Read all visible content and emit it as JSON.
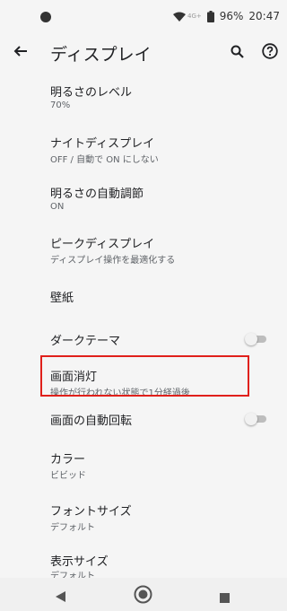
{
  "status": {
    "network": "4G+",
    "battery": "96%",
    "time": "20:47"
  },
  "header": {
    "title": "ディスプレイ"
  },
  "settings": [
    {
      "title": "明るさのレベル",
      "subtitle": "70%"
    },
    {
      "title": "ナイトディスプレイ",
      "subtitle": "OFF / 自動で ON にしない"
    },
    {
      "title": "明るさの自動調節",
      "subtitle": "ON"
    },
    {
      "title": "ピークディスプレイ",
      "subtitle": "ディスプレイ操作を最適化する"
    },
    {
      "title": "壁紙"
    },
    {
      "title": "ダークテーマ",
      "toggle": "off"
    },
    {
      "title": "画面消灯",
      "subtitle": "操作が行われない状態で1分経過後"
    },
    {
      "title": "画面の自動回転",
      "toggle": "off"
    },
    {
      "title": "カラー",
      "subtitle": "ビビッド"
    },
    {
      "title": "フォントサイズ",
      "subtitle": "デフォルト"
    },
    {
      "title": "表示サイズ",
      "subtitle": "デフォルト"
    }
  ],
  "colors": {
    "background": "#f5f5f5",
    "highlight": "#e0201b",
    "toggle_off": "#bdbdbd"
  },
  "icons": [
    "back-arrow-icon",
    "search-icon",
    "help-icon",
    "nav-back-icon",
    "nav-home-icon",
    "nav-recents-icon"
  ]
}
